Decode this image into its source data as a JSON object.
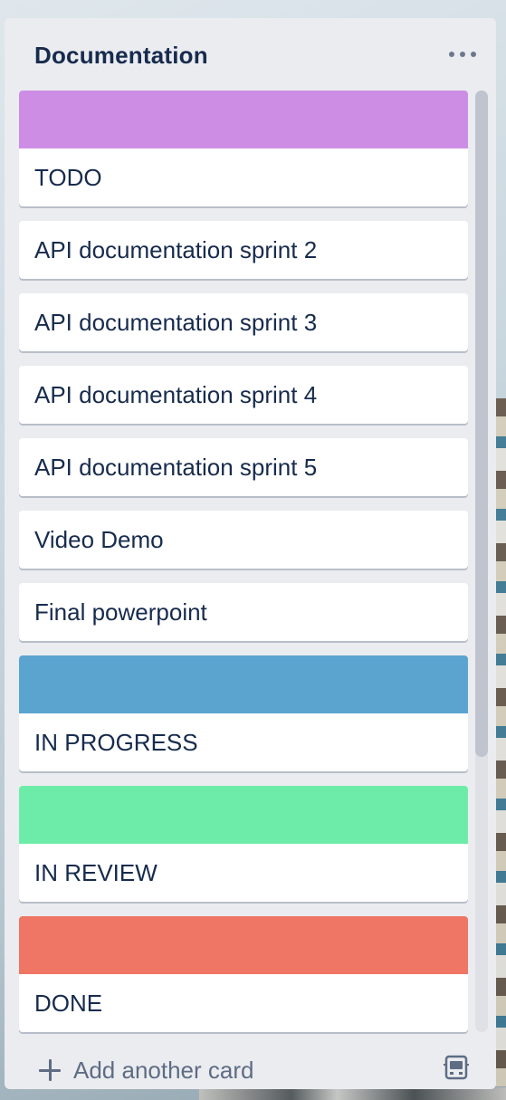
{
  "list": {
    "title": "Documentation",
    "menu_icon": "more-horizontal-icon",
    "cards": [
      {
        "text": "TODO",
        "cover_color": "#cd8de5"
      },
      {
        "text": "API documentation sprint 2",
        "cover_color": null
      },
      {
        "text": "API documentation sprint 3",
        "cover_color": null
      },
      {
        "text": "API documentation sprint 4",
        "cover_color": null
      },
      {
        "text": "API documentation sprint 5",
        "cover_color": null
      },
      {
        "text": "Video Demo",
        "cover_color": null
      },
      {
        "text": "Final powerpoint",
        "cover_color": null
      },
      {
        "text": "IN PROGRESS",
        "cover_color": "#5ba4cf"
      },
      {
        "text": "IN REVIEW",
        "cover_color": "#6deca9"
      },
      {
        "text": "DONE",
        "cover_color": "#ef7564"
      }
    ],
    "footer": {
      "add_card_label": "Add another card",
      "add_icon": "plus-icon",
      "template_icon": "card-template-icon"
    }
  }
}
